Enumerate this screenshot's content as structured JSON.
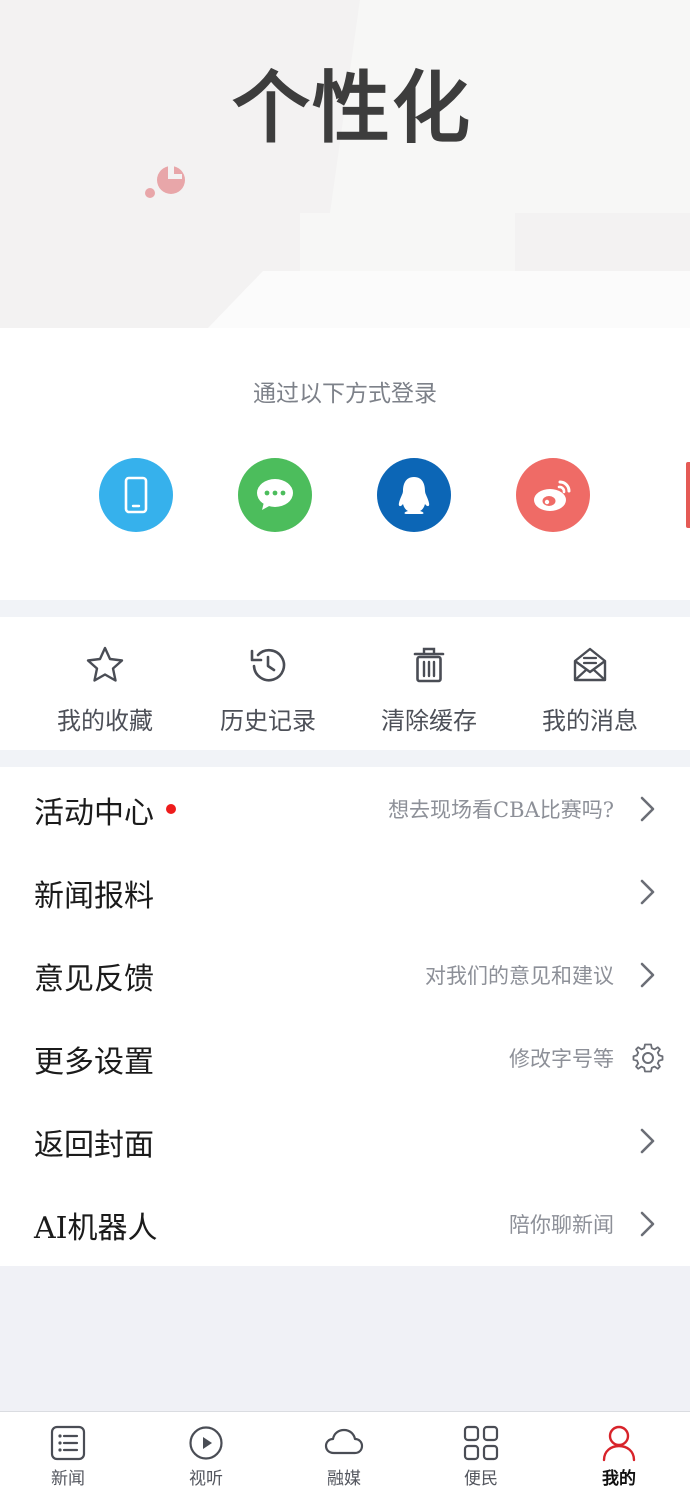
{
  "hero": {
    "title": "个性化"
  },
  "login": {
    "title": "通过以下方式登录",
    "buttons": [
      {
        "icon": "phone-icon",
        "color": "#36b1ec"
      },
      {
        "icon": "wechat-icon",
        "color": "#4cbd5c"
      },
      {
        "icon": "qq-icon",
        "color": "#0c66b6"
      },
      {
        "icon": "weibo-icon",
        "color": "#ef6b66"
      }
    ]
  },
  "quick": [
    {
      "label": "我的收藏",
      "icon": "star-icon"
    },
    {
      "label": "历史记录",
      "icon": "history-icon"
    },
    {
      "label": "清除缓存",
      "icon": "trash-icon"
    },
    {
      "label": "我的消息",
      "icon": "mail-icon"
    }
  ],
  "menu": [
    {
      "label": "活动中心",
      "sub": "想去现场看CBA比赛吗?",
      "dot": true,
      "trail": "chevron-right-icon"
    },
    {
      "label": "新闻报料",
      "sub": "",
      "trail": "chevron-right-icon"
    },
    {
      "label": "意见反馈",
      "sub": "对我们的意见和建议",
      "trail": "chevron-right-icon"
    },
    {
      "label": "更多设置",
      "sub": "修改字号等",
      "trail": "gear-icon"
    },
    {
      "label": "返回封面",
      "sub": "",
      "trail": "chevron-right-icon"
    },
    {
      "label": "AI机器人",
      "sub": "陪你聊新闻",
      "trail": "chevron-right-icon"
    }
  ],
  "tabs": [
    {
      "label": "新闻",
      "icon": "news-list-icon",
      "active": false
    },
    {
      "label": "视听",
      "icon": "play-icon",
      "active": false
    },
    {
      "label": "融媒",
      "icon": "cloud-icon",
      "active": false
    },
    {
      "label": "便民",
      "icon": "grid-icon",
      "active": false
    },
    {
      "label": "我的",
      "icon": "user-icon",
      "active": true
    }
  ],
  "colors": {
    "accent": "#d8232a",
    "icon": "#4a4d55"
  }
}
